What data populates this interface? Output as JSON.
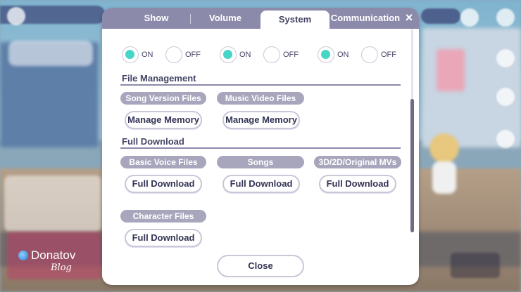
{
  "tabs": [
    {
      "label": "Show",
      "active": false
    },
    {
      "label": "Volume",
      "active": false
    },
    {
      "label": "System",
      "active": true
    },
    {
      "label": "Communication",
      "active": false
    }
  ],
  "close_icon": "×",
  "toggles": [
    {
      "on_label": "ON",
      "off_label": "OFF",
      "selected": "on"
    },
    {
      "on_label": "ON",
      "off_label": "OFF",
      "selected": "on"
    },
    {
      "on_label": "ON",
      "off_label": "OFF",
      "selected": "on"
    }
  ],
  "file_management": {
    "title": "File Management",
    "items": [
      {
        "label": "Song Version Files",
        "button": "Manage Memory"
      },
      {
        "label": "Music Video Files",
        "button": "Manage Memory"
      }
    ]
  },
  "full_download": {
    "title": "Full Download",
    "items": [
      {
        "label": "Basic Voice Files",
        "button": "Full Download"
      },
      {
        "label": "Songs",
        "button": "Full Download"
      },
      {
        "label": "3D/2D/Original MVs",
        "button": "Full Download"
      },
      {
        "label": "Character Files",
        "button": "Full Download"
      }
    ]
  },
  "close_button": "Close",
  "watermark": {
    "line1": "Donatov",
    "line2": "Blog"
  },
  "colors": {
    "accent": "#45d6c8",
    "tab_bar": "#8c8aaa",
    "chip": "#a8a6bd"
  }
}
